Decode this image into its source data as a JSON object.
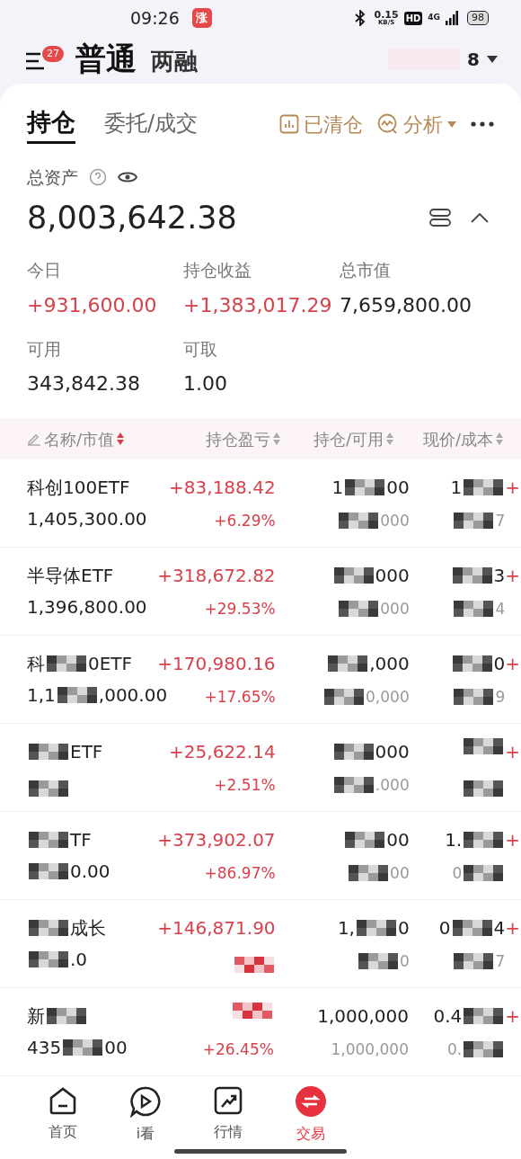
{
  "status_bar": {
    "time": "09:26",
    "badge": "涨",
    "speed": "0.15",
    "speed_unit": "KB/S",
    "hd": "HD",
    "network": "4G",
    "battery": "98"
  },
  "header": {
    "badge": "27",
    "tabs": [
      {
        "label": "普通",
        "selected": true
      },
      {
        "label": "两融",
        "selected": false
      }
    ],
    "account": "8"
  },
  "card": {
    "tabs": [
      {
        "label": "持仓",
        "selected": true
      },
      {
        "label": "委托/成交",
        "selected": false
      }
    ],
    "actions": [
      {
        "label": "已清仓",
        "kind": "chart"
      },
      {
        "label": "分析",
        "kind": "analysis"
      }
    ],
    "total_label": "总资产",
    "total": "8,003,642.38",
    "expanded": true,
    "stats": [
      {
        "label": "今日",
        "value": "+931,600.00",
        "up": true
      },
      {
        "label": "持仓收益",
        "value": "+1,383,017.29",
        "up": true
      },
      {
        "label": "总市值",
        "value": "7,659,800.00",
        "up": false
      },
      {
        "label": "可用",
        "value": "343,842.38",
        "up": false
      },
      {
        "label": "可取",
        "value": "1.00",
        "up": false
      }
    ]
  },
  "table": {
    "columns": [
      {
        "label": "名称/市值",
        "sorted": true
      },
      {
        "label": "持仓盈亏",
        "sorted": false
      },
      {
        "label": "持仓/可用",
        "sorted": false
      },
      {
        "label": "现价/成本",
        "sorted": false
      }
    ],
    "rows": [
      {
        "name": "科创100ETF",
        "value": "1,405,300.00",
        "pnl": "+83,188.42",
        "pct": "+6.29%",
        "qty": {
          "masked": true,
          "before": "1",
          "after": "00"
        },
        "avail": {
          "masked": true,
          "after": "000"
        },
        "price": {
          "masked": true,
          "before": "1"
        },
        "cost": {
          "masked": true,
          "after": "7"
        },
        "column_5": "+"
      },
      {
        "name": "半导体ETF",
        "value": "1,396,800.00",
        "pnl": "+318,672.82",
        "pct": "+29.53%",
        "qty": {
          "masked": true,
          "after": "000"
        },
        "avail": {
          "masked": true,
          "after": "000"
        },
        "price": {
          "masked": true,
          "after": "3"
        },
        "cost": {
          "masked": true,
          "after": "4"
        },
        "column_5": "+"
      },
      {
        "name": {
          "masked": true,
          "before": "科",
          "after": "0ETF"
        },
        "value": {
          "masked": true,
          "before": "1,1",
          "after": ",000.00"
        },
        "pnl": "+170,980.16",
        "pct": "+17.65%",
        "qty": {
          "masked": true,
          "after": ",000"
        },
        "avail": {
          "masked": true,
          "after": "0,000"
        },
        "price": {
          "masked": true,
          "after": "0"
        },
        "cost": {
          "masked": true,
          "after": "9"
        },
        "column_5": "+"
      },
      {
        "name": {
          "masked": true,
          "after": "ETF"
        },
        "value": {
          "masked": true
        },
        "pnl": "+25,622.14",
        "pct": "+2.51%",
        "qty": {
          "masked": true,
          "after": "000"
        },
        "avail": {
          "masked": true,
          "after": ".000"
        },
        "price": {
          "masked": true
        },
        "cost": {
          "masked": true
        },
        "column_5": "+"
      },
      {
        "name": {
          "masked": true,
          "after": "TF"
        },
        "value": {
          "masked": true,
          "after": "0.00"
        },
        "pnl": "+373,902.07",
        "pct": "+86.97%",
        "qty": {
          "masked": true,
          "after": "00"
        },
        "avail": {
          "masked": true,
          "after": "00"
        },
        "price": {
          "masked": true,
          "before": "1."
        },
        "cost": {
          "masked": true,
          "before": "0"
        },
        "column_5": "+"
      },
      {
        "name": {
          "masked": true,
          "after": "成长"
        },
        "value": {
          "masked": true,
          "after": ".0"
        },
        "pnl": "+146,871.90",
        "pct": {
          "masked": true
        },
        "qty": {
          "masked": true,
          "before": "1,",
          "after": "0"
        },
        "avail": {
          "masked": true,
          "after": "0"
        },
        "price": {
          "masked": true,
          "before": "0",
          "after": "4"
        },
        "cost": {
          "masked": true,
          "after": "7"
        },
        "column_5": "+"
      },
      {
        "name": {
          "masked": true,
          "before": "新"
        },
        "value": {
          "masked": true,
          "before": "435",
          "after": "00"
        },
        "pnl": {
          "masked": true
        },
        "pct": "+26.45%",
        "qty": "1,000,000",
        "avail": "1,000,000",
        "price": {
          "masked": true,
          "before": "0.4"
        },
        "cost": {
          "masked": true,
          "before": "0."
        },
        "column_5": "+"
      }
    ]
  },
  "nav": [
    {
      "label": "首页",
      "kind": "home",
      "selected": false
    },
    {
      "label": "i看",
      "kind": "play",
      "selected": false
    },
    {
      "label": "行情",
      "kind": "chart",
      "selected": false
    },
    {
      "label": "交易",
      "kind": "trade",
      "selected": true
    }
  ]
}
